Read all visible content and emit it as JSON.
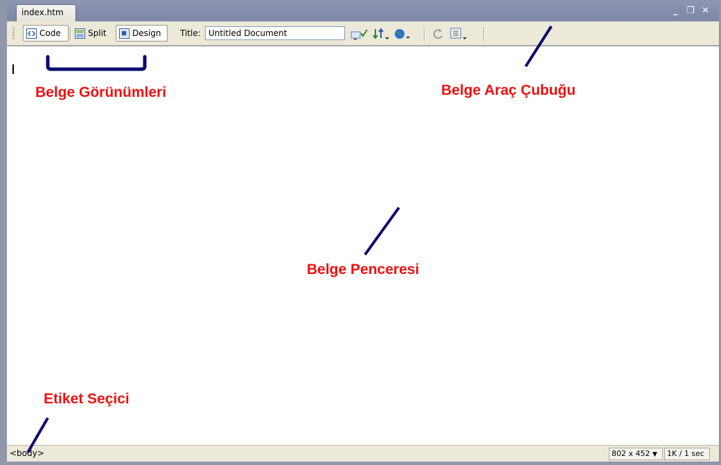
{
  "window": {
    "tab_title": "index.htm",
    "controls": [
      "_",
      "❐",
      "✕"
    ]
  },
  "toolbar": {
    "views": [
      {
        "label": "Code",
        "icon": "code-view-icon",
        "pressed": true
      },
      {
        "label": "Split",
        "icon": "split-view-icon",
        "pressed": false
      },
      {
        "label": "Design",
        "icon": "design-view-icon",
        "pressed": true
      }
    ],
    "title_label": "Title:",
    "title_value": "Untitled Document",
    "tools": [
      "validate-icon",
      "file-transfer-icon",
      "preview-browser-icon",
      "refresh-icon",
      "view-options-icon"
    ]
  },
  "status": {
    "tag_selector": "<body>",
    "window_size": "802 x 452",
    "download": "1K / 1 sec"
  },
  "annotations": {
    "views": "Belge Görünümleri",
    "toolbar": "Belge Araç Çubuğu",
    "window": "Belge Penceresi",
    "tag_selector": "Etiket Seçici",
    "color": "#ee1111",
    "line_color": "#0b0b6e"
  }
}
